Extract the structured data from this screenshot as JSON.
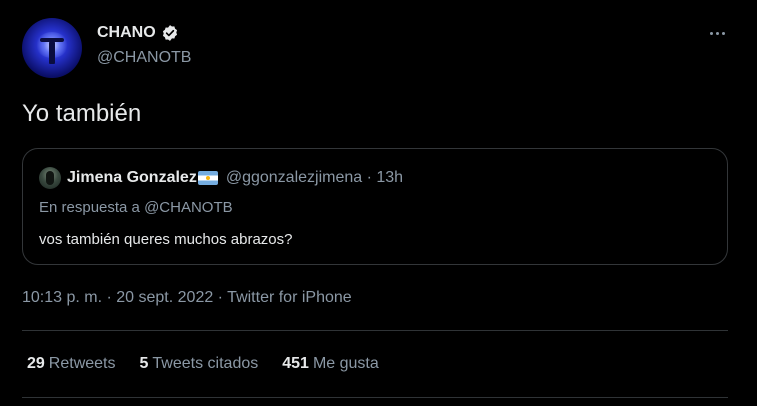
{
  "author": {
    "display_name": "CHANO",
    "handle": "@CHANOTB",
    "verified_icon": "verified-badge-icon",
    "avatar_icon": "concert-silhouette-avatar"
  },
  "tweet": {
    "text": "Yo también"
  },
  "quoted_tweet": {
    "display_name": "Jimena Gonzalez",
    "flag_icon": "argentina-flag-icon",
    "handle_time": "@ggonzalezjimena · 13h",
    "reply_to": "En respuesta a @CHANOTB",
    "text": "vos también queres muchos abrazos?"
  },
  "meta": {
    "time_date": "10:13 p. m. · 20 sept. 2022 · ",
    "source": "Twitter for iPhone"
  },
  "stats": [
    {
      "count": "29",
      "label": "Retweets"
    },
    {
      "count": "5",
      "label": "Tweets citados"
    },
    {
      "count": "451",
      "label": "Me gusta"
    }
  ],
  "colors": {
    "background": "#000000",
    "primary_text": "#e7e9ea",
    "secondary_text": "#8b98a5",
    "border": "#333639"
  }
}
